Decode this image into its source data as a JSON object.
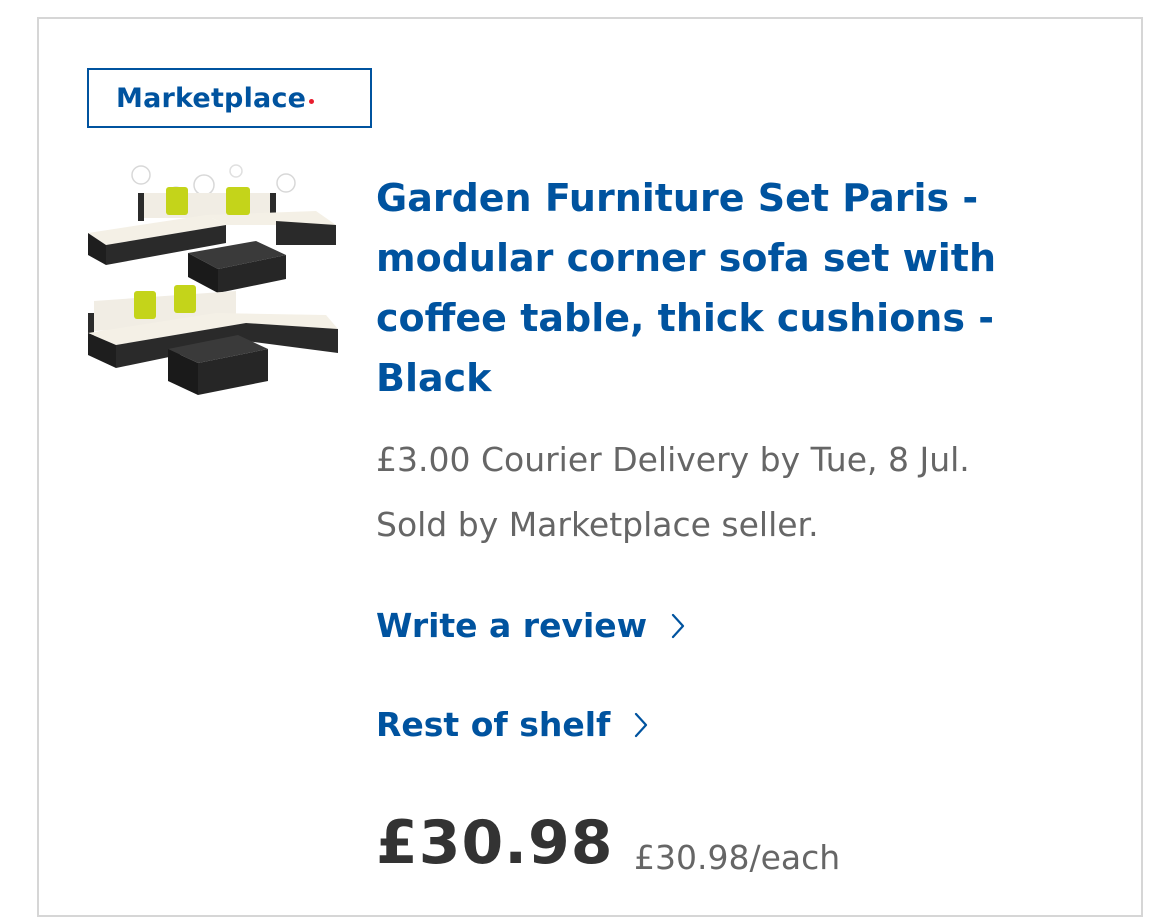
{
  "colors": {
    "brand_blue": "#00539f",
    "text_grey": "#666666",
    "price_dark": "#333333",
    "badge_dot": "#e81c2d",
    "border_grey": "#d6d6d6"
  },
  "badge": {
    "label": "Marketplace",
    "dot_icon": "red-dot-icon"
  },
  "product": {
    "image_alt_icon": "garden-furniture-set-image",
    "title": "Garden Furniture Set Paris - modular corner sofa set with coffee table, thick cushions - Black",
    "delivery": "£3.00 Courier Delivery by Tue, 8 Jul.",
    "seller": "Sold by Marketplace seller.",
    "price": "£30.98",
    "unit_price": "£30.98/each"
  },
  "links": {
    "review_label": "Write a review",
    "shelf_label": "Rest of shelf",
    "chevron_icon": "chevron-right-icon"
  }
}
